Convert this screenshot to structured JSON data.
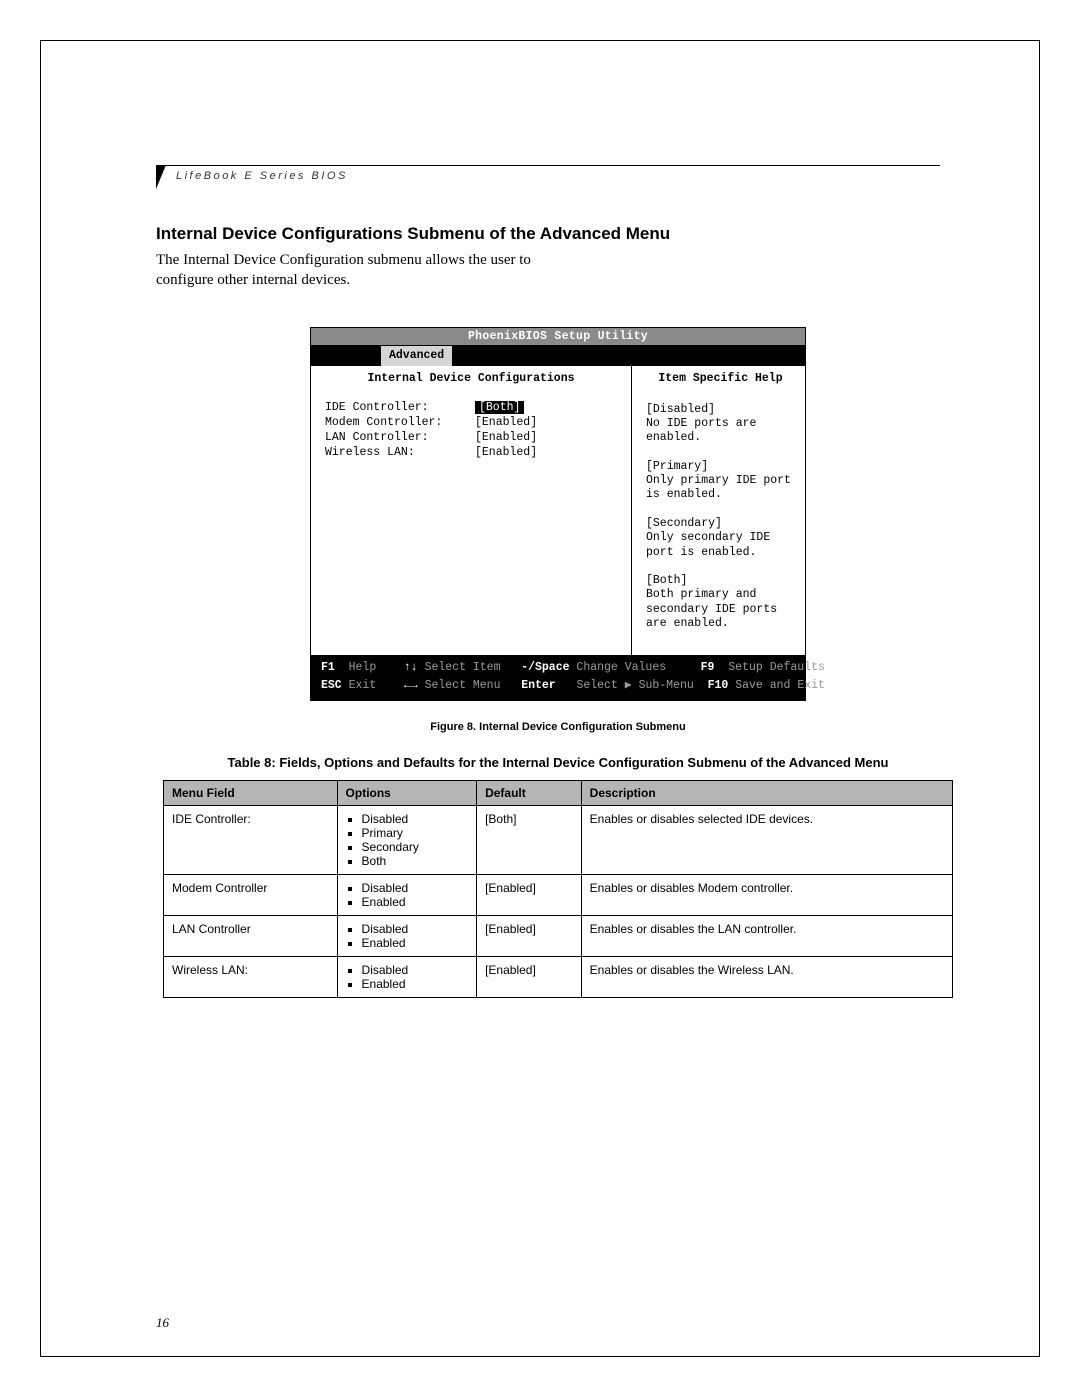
{
  "header": {
    "running_head": "LifeBook E Series BIOS"
  },
  "section": {
    "title": "Internal Device Configurations Submenu of the Advanced Menu",
    "body": "The Internal Device Configuration submenu allows the user to configure other internal devices."
  },
  "bios": {
    "utility_title": "PhoenixBIOS Setup Utility",
    "active_tab": "Advanced",
    "subtitle": "Internal Device Configurations",
    "help_title": "Item Specific Help",
    "settings": [
      {
        "label": "IDE Controller:",
        "value": "[Both]",
        "selected": true
      },
      {
        "label": "Modem Controller:",
        "value": "[Enabled]",
        "selected": false
      },
      {
        "label": "LAN Controller:",
        "value": "[Enabled]",
        "selected": false
      },
      {
        "label": "Wireless LAN:",
        "value": "[Enabled]",
        "selected": false
      }
    ],
    "help": [
      {
        "label": "[Disabled]",
        "text": "No IDE ports are enabled."
      },
      {
        "label": "[Primary]",
        "text": "Only primary IDE port is enabled."
      },
      {
        "label": "[Secondary]",
        "text": "Only secondary IDE port is enabled."
      },
      {
        "label": "[Both]",
        "text": "Both primary and secondary IDE ports are enabled."
      }
    ],
    "footer": {
      "f1": "F1",
      "f1_label": "Help",
      "arrows_ud": "↑↓",
      "select_item": "Select Item",
      "minus_space": "-/Space",
      "change_values": "Change Values",
      "f9": "F9",
      "setup_defaults": "Setup Defaults",
      "esc": "ESC",
      "exit": "Exit",
      "arrows_lr": "←→",
      "select_menu": "Select Menu",
      "enter": "Enter",
      "select_submenu": "Select ▶ Sub-Menu",
      "f10": "F10",
      "save_exit": "Save and Exit"
    }
  },
  "figure_caption": "Figure 8.  Internal Device Configuration Submenu",
  "table_caption": "Table 8: Fields, Options and Defaults for the Internal Device Configuration Submenu of the Advanced Menu",
  "table": {
    "headers": [
      "Menu Field",
      "Options",
      "Default",
      "Description"
    ],
    "rows": [
      {
        "field": "IDE Controller:",
        "options": [
          "Disabled",
          "Primary",
          "Secondary",
          "Both"
        ],
        "default": "[Both]",
        "description": "Enables or disables selected IDE devices."
      },
      {
        "field": "Modem Controller",
        "options": [
          "Disabled",
          "Enabled"
        ],
        "default": "[Enabled]",
        "description": "Enables or disables Modem controller."
      },
      {
        "field": "LAN Controller",
        "options": [
          "Disabled",
          "Enabled"
        ],
        "default": "[Enabled]",
        "description": "Enables or disables the LAN controller."
      },
      {
        "field": "Wireless LAN:",
        "options": [
          "Disabled",
          "Enabled"
        ],
        "default": "[Enabled]",
        "description": "Enables or disables the Wireless LAN."
      }
    ]
  },
  "page_number": "16"
}
